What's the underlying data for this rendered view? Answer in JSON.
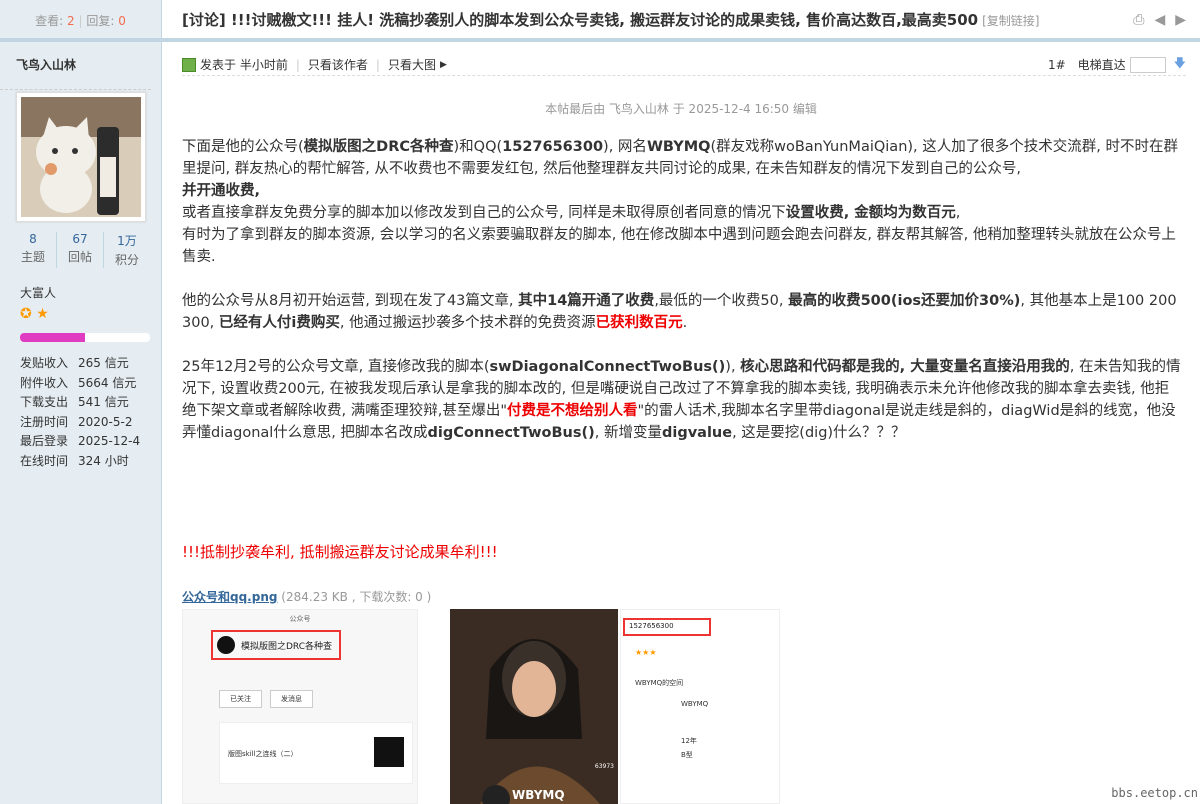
{
  "stats": {
    "view_label": "查看:",
    "views": "2",
    "reply_label": "回复:",
    "replies": "0"
  },
  "user": {
    "name": "飞鸟入山林",
    "topics": "8",
    "topics_label": "主题",
    "posts": "67",
    "posts_label": "回帖",
    "credits": "1万",
    "credits_label": "积分",
    "group": "大富人",
    "level_fraction": 0.5,
    "info": [
      {
        "k": "发贴收入",
        "v": "265 信元"
      },
      {
        "k": "附件收入",
        "v": "5664 信元"
      },
      {
        "k": "下载支出",
        "v": "541 信元"
      },
      {
        "k": "注册时间",
        "v": "2020-5-2"
      },
      {
        "k": "最后登录",
        "v": "2025-12-4"
      },
      {
        "k": "在线时间",
        "v": "324 小时"
      }
    ]
  },
  "thread": {
    "title": "[讨论] !!!讨贼檄文!!! 挂人! 洗稿抄袭别人的脚本发到公众号卖钱, 搬运群友讨论的成果卖钱, 售价高达数百,最高卖500",
    "copy_link": "[复制链接]"
  },
  "post": {
    "posted": "发表于 半小时前",
    "only_author": "只看该作者",
    "only_big": "只看大图",
    "floor": "1#",
    "jump": "电梯直达",
    "edited": "本帖最后由 飞鸟入山林 于 2025-12-4 16:50 编辑"
  },
  "content": {
    "p1a": "下面是他的公众号(",
    "p1b": "模拟版图之DRC各种查",
    "p1c": ")和QQ(",
    "p1d": "1527656300",
    "p1e": "), 网名",
    "p1f": "WBYMQ",
    "p1g": "(群友戏称woBanYunMaiQian), 这人加了很多个技术交流群, 时不时在群里提问, 群友热心的帮忙解答, 从不收费也不需要发红包, 然后他整理群友共同讨论的成果, 在未告知群友的情况下发到自己的公众号,",
    "p1h": "并开通收费,",
    "p2a": "或者直接拿群友免费分享的脚本加以修改发到自己的公众号, 同样是未取得原创者同意的情况下",
    "p2b": "设置收费, 金额均为数百元",
    "p2c": ",",
    "p3": "有时为了拿到群友的脚本资源, 会以学习的名义索要骗取群友的脚本, 他在修改脚本中遇到问题会跑去问群友, 群友帮其解答, 他稍加整理转头就放在公众号上售卖.",
    "p4a": "他的公众号从8月初开始运营, 到现在发了43篇文章, ",
    "p4b": "其中14篇开通了收费",
    "p4c": ",最低的一个收费50, ",
    "p4d": "最高的收费500(ios还要加价30%)",
    "p4e": ", 其他基本上是100 200 300, ",
    "p4f": "已经有人付i费购买",
    "p4g": ", 他通过搬运抄袭多个技术群的免费资源",
    "p4h": "已获利数百元",
    "p4i": ".",
    "p5a": "25年12月2号的公众号文章, 直接修改我的脚本(",
    "p5b": "swDiagonalConnectTwoBus()",
    "p5c": "), ",
    "p5d": "核心思路和代码都是我的, 大量变量名直接沿用我的",
    "p5e": ", 在未告知我的情况下, 设置收费200元, 在被我发现后承认是拿我的脚本改的, 但是嘴硬说自己改过了不算拿我的脚本卖钱, 我明确表示未允许他修改我的脚本拿去卖钱, 他拒绝下架文章或者解除收费, 满嘴歪理狡辩,甚至爆出\"",
    "p5f": "付费是不想给别人看",
    "p5g": "\"的雷人话术,我脚本名字里带diagonal是说走线是斜的，diagWid是斜的线宽，他没弄懂diagonal什么意思, 把脚本名改成",
    "p5h": "digConnectTwoBus()",
    "p5i": ", 新增变量",
    "p5j": "digvalue",
    "p5k": ", 这是要挖(dig)什么？？？",
    "slogan": "!!!抵制抄袭牟利, 抵制搬运群友讨论成果牟利!!!"
  },
  "attachment": {
    "name": "公众号和qq.png",
    "size": "(284.23 KB , 下载次数: 0 )"
  },
  "screenshot": {
    "title": "公众号",
    "account": "模拟版图之DRC各种查",
    "qq": "1527656300",
    "nick": "WBYMQ",
    "btn1": "已关注",
    "btn2": "发消息",
    "article": "版图skill之连线（二）",
    "likes": "63973",
    "age": "12年",
    "gender": "B型",
    "profile": "WBYMQ的空间"
  },
  "watermark": "bbs.eetop.cn",
  "colors": {
    "accent": "#369",
    "border": "#c2d5e3",
    "red": "#e00",
    "sidebar": "#e5edf2"
  }
}
